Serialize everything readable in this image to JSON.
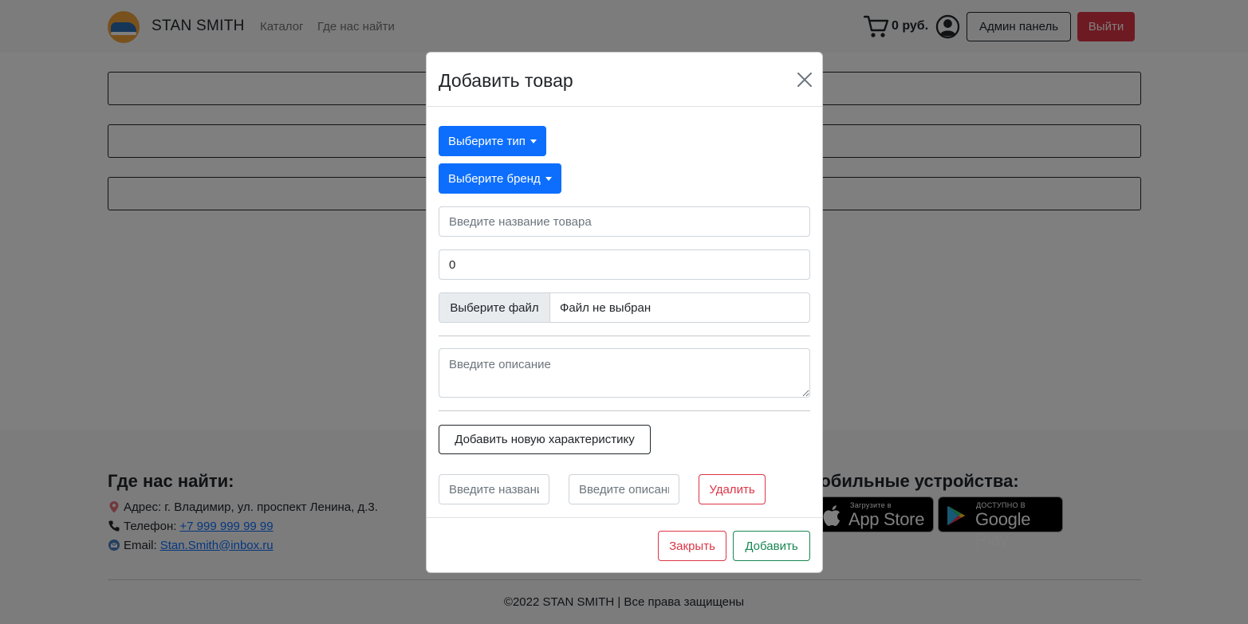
{
  "navbar": {
    "brand": "STAN SMITH",
    "links": [
      "Каталог",
      "Где нас найти"
    ],
    "cart_total": "0 руб.",
    "admin_button": "Админ панель",
    "logout_button": "Выйти",
    "logout_color": "#dc3545"
  },
  "footer": {
    "find_us_title": "Где нас найти:",
    "address": "Адрес: г. Владимир, ул. проспект Ленина, д.3.",
    "phone_label": "Телефон:",
    "phone": "+7 999 999 99 99",
    "email_label": "Email:",
    "email": "Stan.Smith@inbox.ru",
    "mobile_title": "Мобильные устройства:",
    "app_store_small": "Загрузите в",
    "app_store_big": "App Store",
    "google_play_small": "ДОСТУПНО В",
    "google_play_big": "Google Play",
    "copyright": "©2022 STAN SMITH | Все права защищены"
  },
  "modal": {
    "title": "Добавить товар",
    "type_dropdown": "Выберите тип",
    "brand_dropdown": "Выберите бренд",
    "name_placeholder": "Введите название товара",
    "price_value": "0",
    "file_button": "Выберите файл",
    "file_status": "Файл не выбран",
    "description_placeholder": "Введите описание",
    "add_characteristic_button": "Добавить новую характеристику",
    "char_name_placeholder": "Введите название",
    "char_desc_placeholder": "Введите описание",
    "delete_button": "Удалить",
    "close_button": "Закрыть",
    "submit_button": "Добавить",
    "primary_color": "#0d6efd",
    "danger_color": "#dc3545",
    "success_color": "#198754"
  }
}
